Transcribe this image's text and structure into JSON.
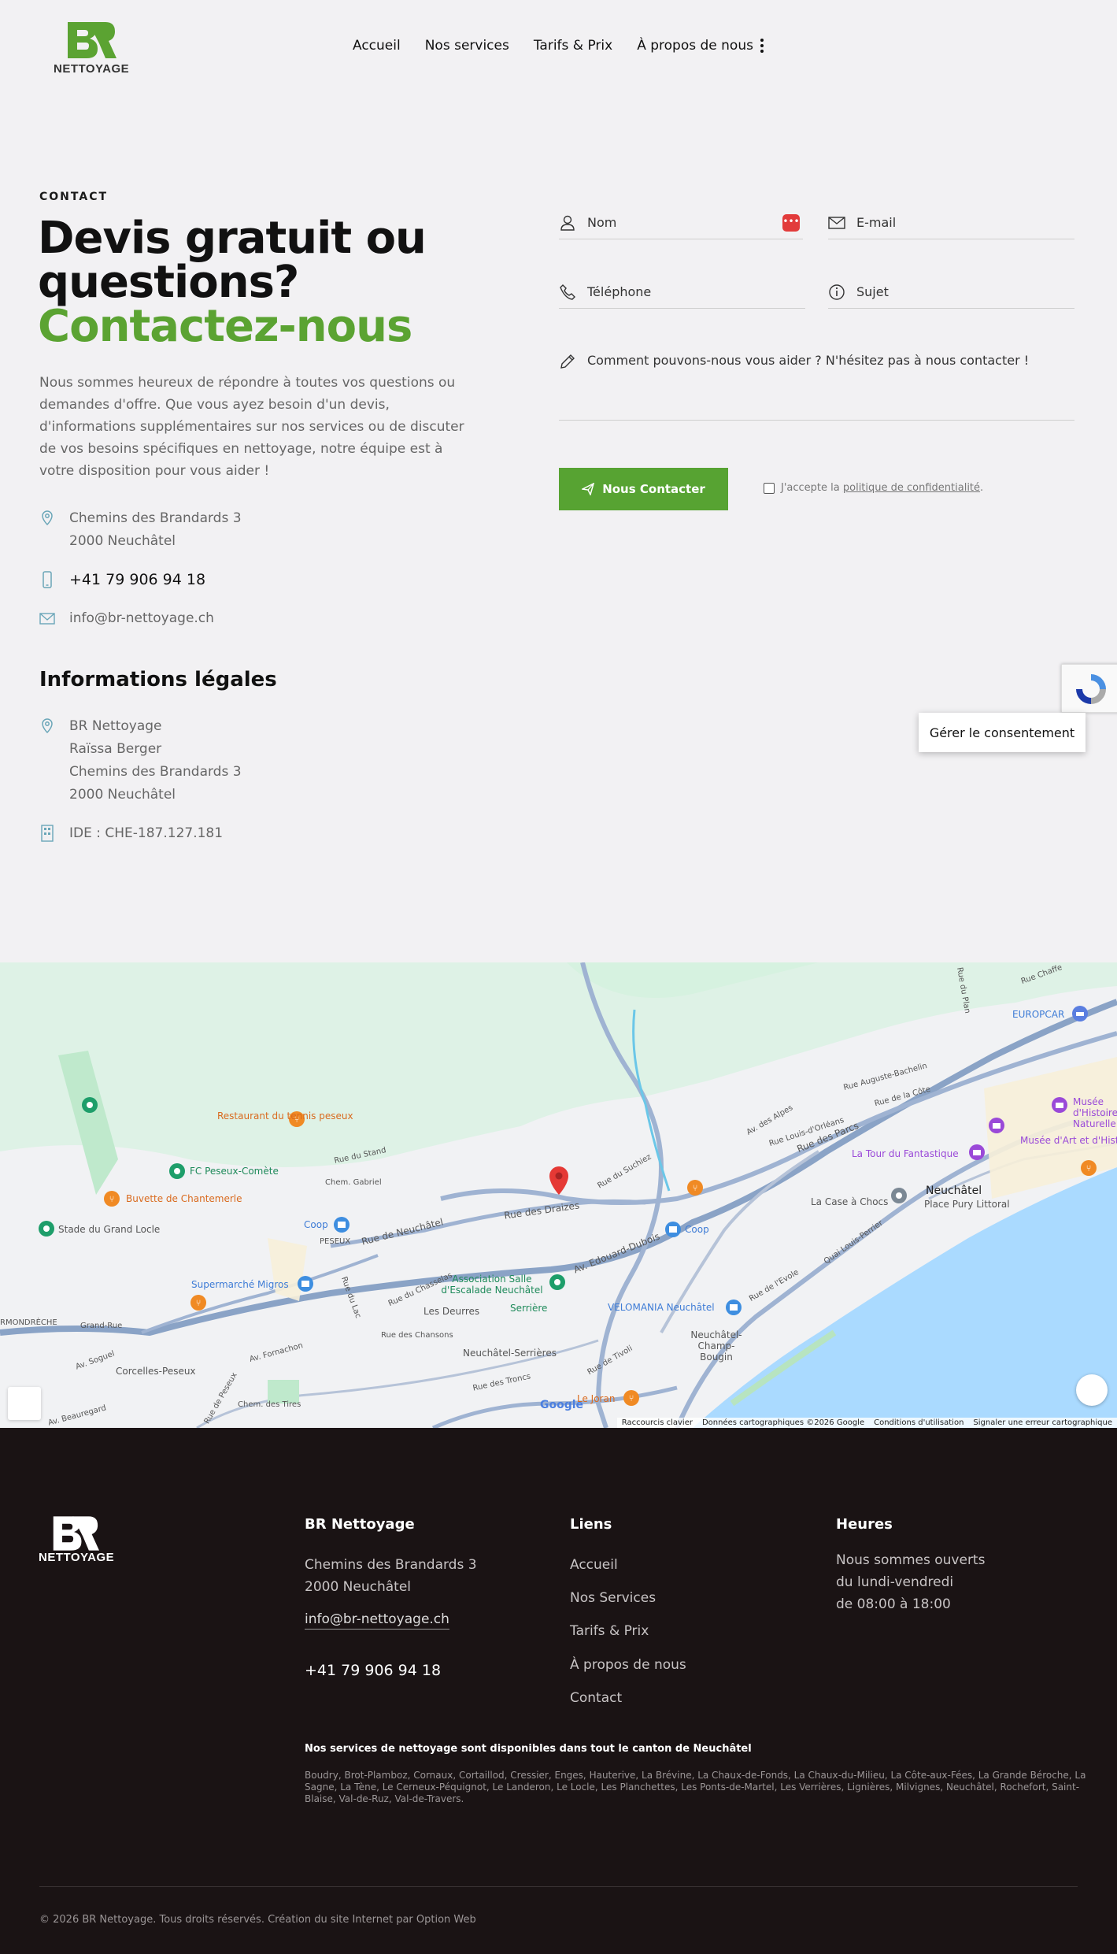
{
  "brand": {
    "logo_text": "NETTOYAGE",
    "accent": "#5ba332"
  },
  "nav": {
    "items": [
      "Accueil",
      "Nos services",
      "Tarifs & Prix",
      "À propos de nous"
    ]
  },
  "contact": {
    "eyebrow": "CONTACT",
    "title_line1": "Devis gratuit ou",
    "title_line2": "questions?",
    "title_green": "Contactez-nous",
    "intro": "Nous sommes heureux de répondre à toutes vos questions ou demandes d'offre. Que vous ayez besoin d'un devis, d'informations supplémentaires sur nos services ou de discuter de vos besoins spécifiques en nettoyage, notre équipe est à votre disposition pour vous aider !",
    "address_line1": "Chemins des Brandards 3",
    "address_line2": "2000 Neuchâtel",
    "phone": "+41 79 906 94 18",
    "email": "info@br-nettoyage.ch"
  },
  "legal": {
    "title": "Informations légales",
    "company": "BR Nettoyage",
    "person": "Raïssa Berger",
    "address_line1": "Chemins des Brandards 3",
    "address_line2": "2000 Neuchâtel",
    "ide": "IDE : CHE-187.127.181"
  },
  "form": {
    "name_placeholder": "Nom",
    "email_placeholder": "E-mail",
    "phone_placeholder": "Téléphone",
    "subject_placeholder": "Sujet",
    "message_placeholder": "Comment pouvons-nous vous aider ? N'hésitez pas à nous contacter !",
    "submit_label": "Nous Contacter",
    "consent_prefix": "J'accepte la",
    "consent_link": "politique de confidentialité",
    "consent_suffix": "."
  },
  "overlay": {
    "consent_button": "Gérer le consentement"
  },
  "map": {
    "labels": {
      "restaurant": "Restaurant du tennis peseux",
      "fc": "FC Peseux-Comète",
      "buvette": "Buvette de Chantemerle",
      "stade": "Stade du Grand Locle",
      "coop1": "Coop",
      "coop2": "Coop",
      "migros": "Supermarché Migros",
      "association": "Association Salle d'Escalade Neuchâtel",
      "serriere": "Serrière",
      "velomania": "VELOMANIA Neuchâtel",
      "deurres": "Les Deurres",
      "serrieres_station": "Neuchâtel-Serrières",
      "champ_bougin": "Neuchâtel-Champ-Bougin",
      "corcelles": "Corcelles-Peseux",
      "le_joran": "Le Joran",
      "europcar": "EUROPCAR",
      "musee_nat": "Musée d'Histoire Naturelle",
      "musee_art": "Musée d'Art et d'Histoire",
      "tour": "La Tour du Fantastique",
      "case": "La Case à Chocs",
      "neuchatel": "Neuchâtel",
      "place_pury": "Place Pury Littoral",
      "peseux": "PESEUX",
      "rue_draizes": "Rue des Draizes",
      "rue_neuchatel": "Rue de Neuchâtel",
      "edouard": "Av. Edouard-Dubois",
      "rue_parcs": "Rue des Parcs",
      "av_alpes": "Av. des Alpes",
      "quai": "Quai Louis-Perrier",
      "rue_evole": "Rue de l'Evole",
      "fornachon": "Av. Fornachon",
      "grand_rue": "Grand-Rue",
      "soguel": "Av. Soguel",
      "beauregard": "Av. Beauregard",
      "tivoli": "Rue de Tivoli",
      "peseux_rue": "Rue de Peseux",
      "stand": "Rue du Stand",
      "gabriel": "Chem. Gabriel",
      "chasselas": "Rue du Chasselas",
      "chansons": "Rue des Chansons",
      "troncs": "Rue des Troncs",
      "tires": "Chem. des Tires",
      "lac": "Rue du Lac",
      "suchiez": "Rue du Suchiez",
      "plan": "Rue du Plan",
      "ormondreche": "RMONDRÈCHE",
      "bachelin": "Rue Auguste-Bachelin",
      "cote": "Rue de la Côte",
      "orleans": "Rue Louis-d'Orléans",
      "chaffe": "Rue Chaffe"
    },
    "footer": [
      "Raccourcis clavier",
      "Données cartographiques ©2026 Google",
      "Conditions d'utilisation",
      "Signaler une erreur cartographique"
    ],
    "google": "Google"
  },
  "footer": {
    "logo_text": "NETTOYAGE",
    "company_title": "BR Nettoyage",
    "address_line1": "Chemins des Brandards 3",
    "address_line2": "2000 Neuchâtel",
    "email": "info@br-nettoyage.ch",
    "phone": "+41 79 906 94 18",
    "links_title": "Liens",
    "links": [
      "Accueil",
      "Nos Services",
      "Tarifs & Prix",
      "À propos de nous",
      "Contact"
    ],
    "hours_title": "Heures",
    "hours_line1": "Nous sommes ouverts",
    "hours_line2": "du lundi-vendredi",
    "hours_line3": "de 08:00 à 18:00",
    "services_title": "Nos services de nettoyage sont disponibles dans tout le canton de Neuchâtel",
    "services_text": "Boudry, Brot-Plamboz, Cornaux, Cortaillod, Cressier, Enges, Hauterive, La Brévine, La Chaux-de-Fonds, La Chaux-du-Milieu, La Côte-aux-Fées, La Grande Béroche, La Sagne, La Tène, Le Cerneux-Péquignot, Le Landeron, Le Locle, Les Planchettes, Les Ponts-de-Martel, Les Verrières, Lignières, Milvignes, Neuchâtel, Rochefort, Saint-Blaise, Val-de-Ruz, Val-de-Travers.",
    "copyright": "© 2026 BR Nettoyage. Tous droits réservés. Création du site Internet par Option Web"
  }
}
